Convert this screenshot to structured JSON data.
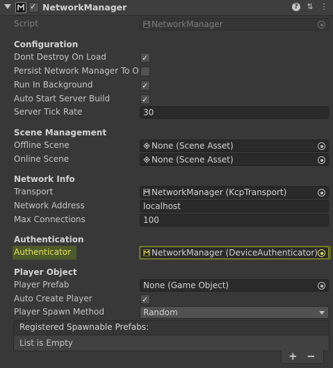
{
  "component": {
    "title": "NetworkManager"
  },
  "script": {
    "label": "Script",
    "value": "NetworkManager"
  },
  "sections": {
    "configuration": "Configuration",
    "scene_management": "Scene Management",
    "network_info": "Network Info",
    "authentication": "Authentication",
    "player_object": "Player Object"
  },
  "config": {
    "dont_destroy": {
      "label": "Dont Destroy On Load",
      "checked": true
    },
    "persist": {
      "label": "Persist Network Manager To Offline Scene",
      "checked": false
    },
    "run_bg": {
      "label": "Run In Background",
      "checked": true
    },
    "auto_start": {
      "label": "Auto Start Server Build",
      "checked": true
    },
    "tick_rate": {
      "label": "Server Tick Rate",
      "value": "30"
    }
  },
  "scenes": {
    "offline": {
      "label": "Offline Scene",
      "value": "None (Scene Asset)"
    },
    "online": {
      "label": "Online Scene",
      "value": "None (Scene Asset)"
    }
  },
  "network": {
    "transport": {
      "label": "Transport",
      "value": "NetworkManager (KcpTransport)"
    },
    "address": {
      "label": "Network Address",
      "value": "localhost"
    },
    "max_conn": {
      "label": "Max Connections",
      "value": "100"
    }
  },
  "auth": {
    "authenticator": {
      "label": "Authenticator",
      "value": "NetworkManager (DeviceAuthenticator)"
    }
  },
  "player": {
    "prefab": {
      "label": "Player Prefab",
      "value": "None (Game Object)"
    },
    "auto_create": {
      "label": "Auto Create Player",
      "checked": true
    },
    "spawn_method": {
      "label": "Player Spawn Method",
      "value": "Random"
    }
  },
  "spawnables": {
    "header": "Registered Spawnable Prefabs:",
    "empty": "List is Empty",
    "add": "+",
    "remove": "−"
  },
  "colors": {
    "highlight": "#e4e25b",
    "background": "#383838"
  }
}
